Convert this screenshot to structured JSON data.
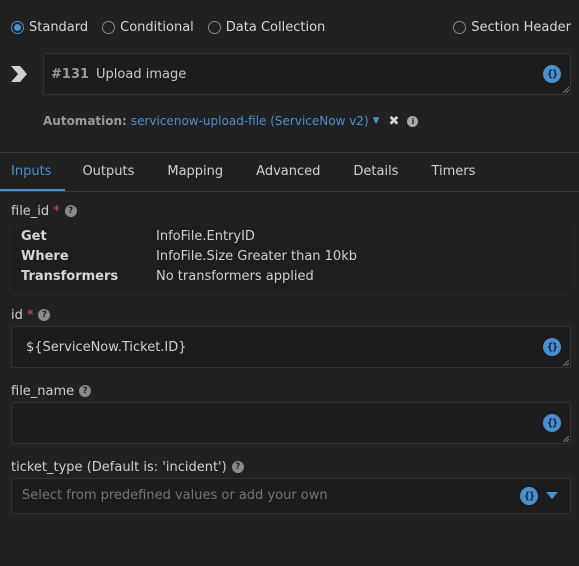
{
  "step_types": [
    {
      "label": "Standard",
      "selected": true
    },
    {
      "label": "Conditional",
      "selected": false
    },
    {
      "label": "Data Collection",
      "selected": false
    }
  ],
  "section_header": {
    "label": "Section Header",
    "selected": false
  },
  "task": {
    "number": "#131",
    "name": "Upload image"
  },
  "automation": {
    "label": "Automation:",
    "value": "servicenow-upload-file (ServiceNow v2)"
  },
  "tabs": [
    "Inputs",
    "Outputs",
    "Mapping",
    "Advanced",
    "Details",
    "Timers"
  ],
  "active_tab": "Inputs",
  "fields": {
    "file_id": {
      "label": "file_id",
      "required": "*",
      "rows": [
        {
          "key": "Get",
          "value": "InfoFile.EntryID"
        },
        {
          "key": "Where",
          "value": "InfoFile.Size Greater than 10kb"
        },
        {
          "key": "Transformers",
          "value": "No transformers applied"
        }
      ]
    },
    "id": {
      "label": "id",
      "required": "*",
      "value": "${ServiceNow.Ticket.ID}"
    },
    "file_name": {
      "label": "file_name",
      "value": ""
    },
    "ticket_type": {
      "label": "ticket_type (Default is: 'incident')",
      "placeholder": "Select from predefined values or add your own"
    }
  },
  "colors": {
    "accent": "#4a8fd0",
    "required": "#d25050",
    "background": "#212121"
  },
  "icons": {
    "code": "{}",
    "info": "i",
    "help": "?",
    "clear": "✖"
  }
}
